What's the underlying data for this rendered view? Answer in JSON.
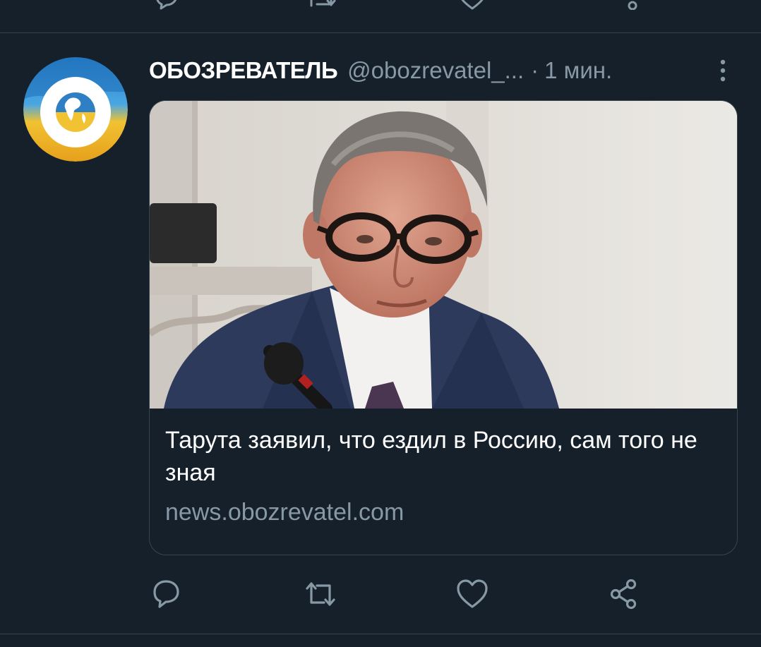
{
  "tweet": {
    "display_name": "ОБОЗРЕВАТЕЛЬ",
    "handle": "@obozrevatel_...",
    "separator": "·",
    "time": "1 мин.",
    "card": {
      "title": "Тарута заявил, что ездил в Россию, сам того не зная",
      "domain": "news.obozrevatel.com"
    }
  },
  "icons": {
    "more": "more-vertical-icon",
    "reply": "reply-icon",
    "retweet": "retweet-icon",
    "like": "heart-icon",
    "share": "share-icon"
  },
  "colors": {
    "background": "#15202b",
    "divider": "#38444d",
    "secondary_text": "#8899a6",
    "primary_text": "#ffffff"
  }
}
